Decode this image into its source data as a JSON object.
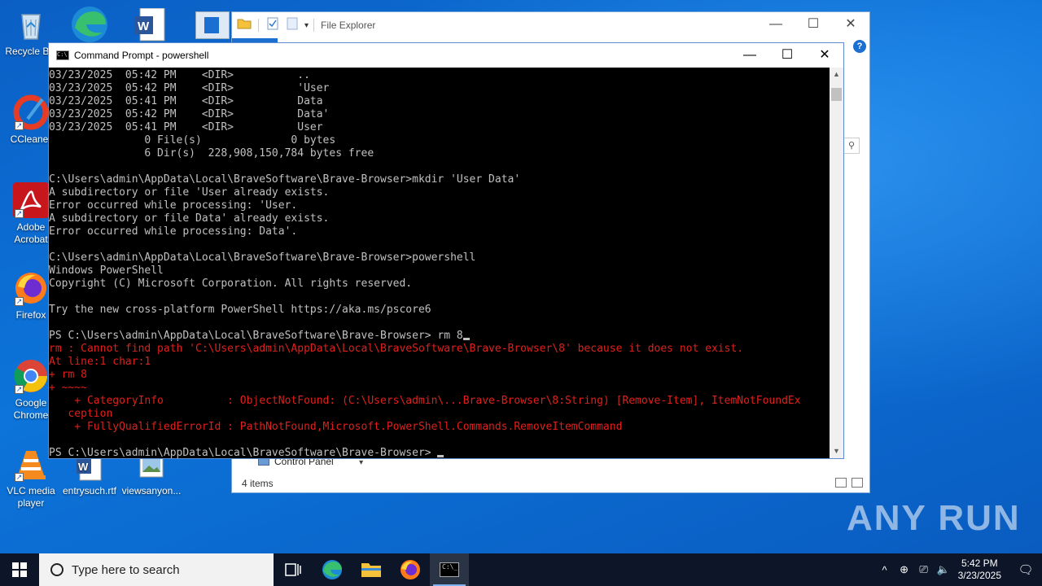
{
  "desktop": {
    "icons": [
      {
        "label": "Recycle Bin",
        "name": "recycle-bin-icon"
      },
      {
        "label": "CCleaner",
        "name": "ccleaner-icon"
      },
      {
        "label": "Adobe Acrobat",
        "name": "adobe-acrobat-icon"
      },
      {
        "label": "Firefox",
        "name": "firefox-icon"
      },
      {
        "label": "Google Chrome",
        "name": "chrome-icon"
      },
      {
        "label": "VLC media player",
        "name": "vlc-icon"
      },
      {
        "label": "entrysuch.rtf",
        "name": "word-doc-icon"
      },
      {
        "label": "viewsanyon...",
        "name": "image-file-icon"
      }
    ],
    "watermark": "ANY RUN"
  },
  "explorer": {
    "title": "File Explorer",
    "status": "4 items",
    "visible_item": "Control Panel",
    "help": "?"
  },
  "cmd": {
    "title": "Command Prompt - powershell",
    "lines": [
      {
        "text": "03/23/2025  05:42 PM    <DIR>          ..",
        "err": false
      },
      {
        "text": "03/23/2025  05:42 PM    <DIR>          'User",
        "err": false
      },
      {
        "text": "03/23/2025  05:41 PM    <DIR>          Data",
        "err": false
      },
      {
        "text": "03/23/2025  05:42 PM    <DIR>          Data'",
        "err": false
      },
      {
        "text": "03/23/2025  05:41 PM    <DIR>          User",
        "err": false
      },
      {
        "text": "               0 File(s)              0 bytes",
        "err": false
      },
      {
        "text": "               6 Dir(s)  228,908,150,784 bytes free",
        "err": false
      },
      {
        "text": "",
        "err": false
      },
      {
        "text": "C:\\Users\\admin\\AppData\\Local\\BraveSoftware\\Brave-Browser>mkdir 'User Data'",
        "err": false
      },
      {
        "text": "A subdirectory or file 'User already exists.",
        "err": false
      },
      {
        "text": "Error occurred while processing: 'User.",
        "err": false
      },
      {
        "text": "A subdirectory or file Data' already exists.",
        "err": false
      },
      {
        "text": "Error occurred while processing: Data'.",
        "err": false
      },
      {
        "text": "",
        "err": false
      },
      {
        "text": "C:\\Users\\admin\\AppData\\Local\\BraveSoftware\\Brave-Browser>powershell",
        "err": false
      },
      {
        "text": "Windows PowerShell",
        "err": false
      },
      {
        "text": "Copyright (C) Microsoft Corporation. All rights reserved.",
        "err": false
      },
      {
        "text": "",
        "err": false
      },
      {
        "text": "Try the new cross-platform PowerShell https://aka.ms/pscore6",
        "err": false
      },
      {
        "text": "",
        "err": false
      },
      {
        "text": "PS C:\\Users\\admin\\AppData\\Local\\BraveSoftware\\Brave-Browser> rm 8",
        "err": false,
        "cursor": true
      },
      {
        "text": "rm : Cannot find path 'C:\\Users\\admin\\AppData\\Local\\BraveSoftware\\Brave-Browser\\8' because it does not exist.",
        "err": true
      },
      {
        "text": "At line:1 char:1",
        "err": true
      },
      {
        "text": "+ rm 8",
        "err": true
      },
      {
        "text": "+ ~~~~",
        "err": true
      },
      {
        "text": "    + CategoryInfo          : ObjectNotFound: (C:\\Users\\admin\\...Brave-Browser\\8:String) [Remove-Item], ItemNotFoundEx",
        "err": true
      },
      {
        "text": "   ception",
        "err": true
      },
      {
        "text": "    + FullyQualifiedErrorId : PathNotFound,Microsoft.PowerShell.Commands.RemoveItemCommand",
        "err": true
      },
      {
        "text": "",
        "err": false
      },
      {
        "text": "PS C:\\Users\\admin\\AppData\\Local\\BraveSoftware\\Brave-Browser> ",
        "err": false,
        "cursor": true
      }
    ]
  },
  "taskbar": {
    "search_placeholder": "Type here to search",
    "time": "5:42 PM",
    "date": "3/23/2025"
  }
}
